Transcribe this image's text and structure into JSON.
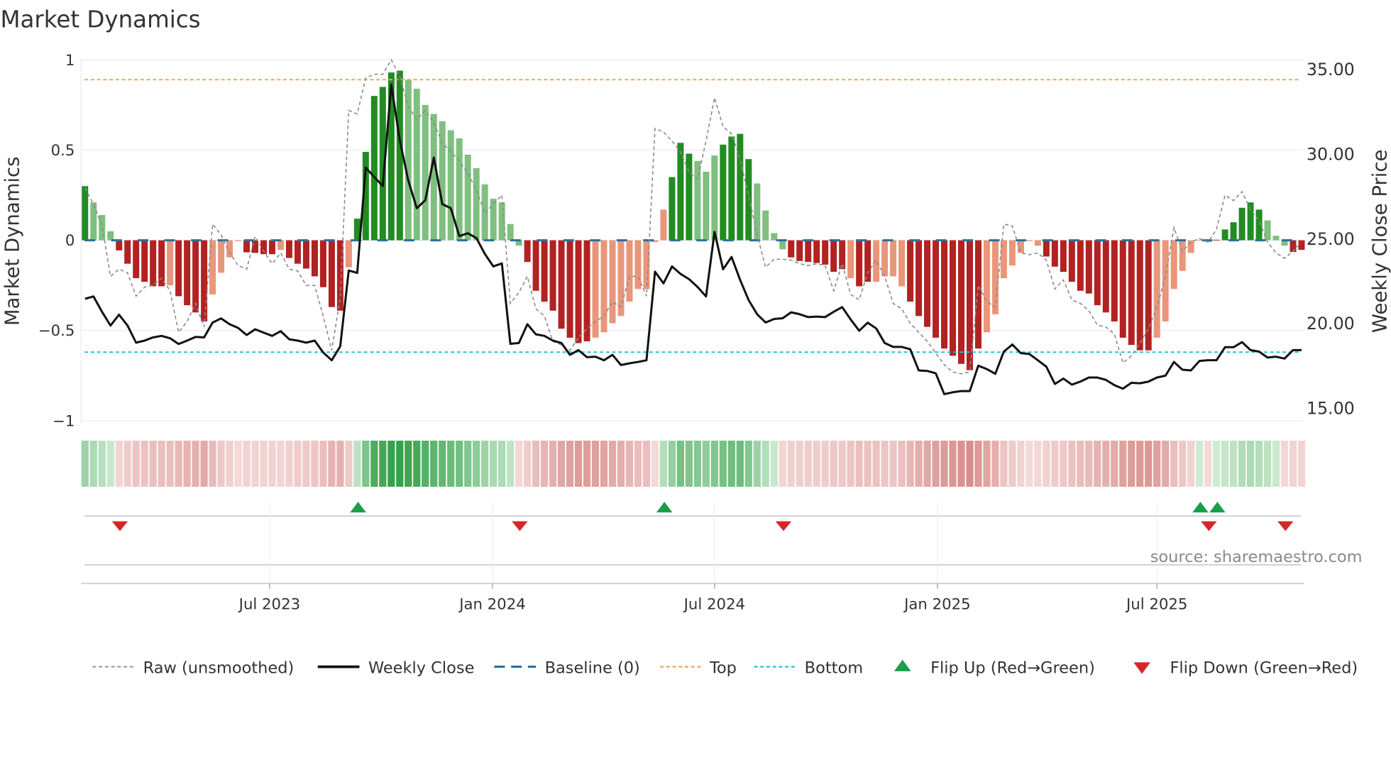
{
  "chart_data": {
    "type": "bar",
    "title": "Market Dynamics",
    "ylabel_left": "Market Dynamics",
    "ylabel_right": "Weekly Close Price",
    "ylim_left": [
      -1,
      1
    ],
    "ylim_right": [
      13.9,
      36.1
    ],
    "left_ticks": [
      {
        "v": 1,
        "label": "1"
      },
      {
        "v": 0.5,
        "label": "0.5"
      },
      {
        "v": 0,
        "label": "0"
      },
      {
        "v": -0.5,
        "label": "−0.5"
      },
      {
        "v": -1,
        "label": "−1"
      }
    ],
    "right_ticks": [
      {
        "v": 35,
        "label": "35.00"
      },
      {
        "v": 30,
        "label": "30.00"
      },
      {
        "v": 25,
        "label": "25.00"
      },
      {
        "v": 20,
        "label": "20.00"
      },
      {
        "v": 15,
        "label": "15.00"
      }
    ],
    "x_ticks": [
      {
        "week": 21.7,
        "label": "Jul 2023"
      },
      {
        "week": 47.9,
        "label": "Jan 2024"
      },
      {
        "week": 74.0,
        "label": "Jul 2024"
      },
      {
        "week": 100.2,
        "label": "Jan 2025"
      },
      {
        "week": 126.0,
        "label": "Jul 2025"
      }
    ],
    "top_level": 0.89,
    "bottom_level": -0.62,
    "baseline": 0,
    "bars": [
      0.3,
      0.21,
      0.14,
      0.05,
      -0.056,
      -0.13,
      -0.21,
      -0.23,
      -0.255,
      -0.255,
      -0.25,
      -0.31,
      -0.36,
      -0.4,
      -0.45,
      -0.3,
      -0.18,
      -0.095,
      -0.005,
      -0.067,
      -0.07,
      -0.077,
      -0.077,
      -0.053,
      -0.098,
      -0.13,
      -0.157,
      -0.2,
      -0.26,
      -0.37,
      -0.39,
      -0.15,
      0.12,
      0.49,
      0.8,
      0.85,
      0.93,
      0.94,
      0.89,
      0.84,
      0.75,
      0.7,
      0.66,
      0.61,
      0.565,
      0.475,
      0.4,
      0.31,
      0.23,
      0.21,
      0.09,
      -0.03,
      -0.12,
      -0.28,
      -0.34,
      -0.39,
      -0.49,
      -0.54,
      -0.57,
      -0.56,
      -0.54,
      -0.51,
      -0.46,
      -0.42,
      -0.34,
      -0.27,
      -0.27,
      -0.01,
      0.17,
      0.35,
      0.54,
      0.48,
      0.44,
      0.38,
      0.47,
      0.53,
      0.575,
      0.59,
      0.45,
      0.315,
      0.165,
      0.04,
      -0.05,
      -0.095,
      -0.115,
      -0.12,
      -0.126,
      -0.135,
      -0.175,
      -0.16,
      -0.21,
      -0.255,
      -0.23,
      -0.23,
      -0.2,
      -0.2,
      -0.255,
      -0.34,
      -0.42,
      -0.48,
      -0.54,
      -0.6,
      -0.64,
      -0.685,
      -0.72,
      -0.6,
      -0.51,
      -0.41,
      -0.21,
      -0.14,
      -0.07,
      -0.005,
      -0.03,
      -0.09,
      -0.146,
      -0.175,
      -0.23,
      -0.28,
      -0.295,
      -0.36,
      -0.4,
      -0.45,
      -0.54,
      -0.58,
      -0.61,
      -0.61,
      -0.54,
      -0.45,
      -0.27,
      -0.17,
      -0.07,
      0.003,
      -0.01,
      0.003,
      0.06,
      0.1,
      0.18,
      0.21,
      0.17,
      0.11,
      0.025,
      -0.03,
      -0.065,
      -0.053
    ],
    "bar_shades": "GggwRRRRRRrRRRRrrrrRRRRrRRRRRRRrGGGGGGggggggggggggggRRRRRRRRrrrrrrrrrGGGgggGGGGggggRRRRRRRrRRrrrrRRRRRRRRRrrrrrrrRRRRRRRRRRRRRrrrrrrgRGGGGGgggRRr",
    "raw": [
      0.29,
      0.2,
      0.08,
      -0.2,
      -0.16,
      -0.18,
      -0.31,
      -0.26,
      -0.25,
      -0.21,
      -0.28,
      -0.51,
      -0.45,
      -0.35,
      -0.48,
      0.09,
      0.03,
      -0.07,
      -0.14,
      -0.16,
      0.02,
      -0.06,
      -0.13,
      -0.07,
      -0.16,
      -0.17,
      -0.25,
      -0.25,
      -0.42,
      -0.61,
      -0.32,
      0.72,
      0.7,
      0.9,
      0.92,
      0.92,
      1.0,
      0.91,
      0.74,
      0.67,
      0.72,
      0.65,
      0.54,
      0.49,
      0.44,
      0.37,
      0.28,
      0.15,
      0.2,
      0.25,
      -0.35,
      -0.29,
      -0.2,
      -0.38,
      -0.42,
      -0.56,
      -0.58,
      -0.61,
      -0.54,
      -0.49,
      -0.45,
      -0.42,
      -0.34,
      -0.37,
      -0.2,
      -0.2,
      -0.31,
      0.62,
      0.6,
      0.55,
      0.49,
      0.38,
      0.34,
      0.55,
      0.79,
      0.63,
      0.59,
      0.45,
      0.25,
      0.03,
      -0.15,
      -0.105,
      -0.105,
      -0.11,
      -0.13,
      -0.14,
      -0.13,
      -0.14,
      -0.28,
      -0.13,
      -0.3,
      -0.33,
      -0.18,
      -0.11,
      -0.2,
      -0.35,
      -0.38,
      -0.46,
      -0.51,
      -0.56,
      -0.625,
      -0.69,
      -0.73,
      -0.74,
      -0.73,
      -0.25,
      -0.34,
      -0.37,
      0.09,
      0.08,
      -0.07,
      -0.08,
      -0.07,
      -0.11,
      -0.27,
      -0.22,
      -0.33,
      -0.35,
      -0.39,
      -0.47,
      -0.48,
      -0.52,
      -0.68,
      -0.64,
      -0.57,
      -0.49,
      -0.37,
      -0.2,
      0.07,
      -0.06,
      -0.01,
      0.01,
      -0.01,
      0.06,
      0.25,
      0.22,
      0.27,
      0.17,
      0.11,
      -0.01,
      -0.07,
      -0.1,
      -0.06,
      -0.01
    ],
    "close": [
      21.44,
      21.58,
      20.67,
      19.86,
      20.5,
      19.86,
      18.85,
      18.97,
      19.16,
      19.25,
      19.11,
      18.77,
      18.97,
      19.19,
      19.16,
      20.04,
      20.28,
      19.94,
      19.72,
      19.3,
      19.64,
      19.44,
      19.25,
      19.53,
      19.05,
      18.97,
      18.85,
      18.97,
      18.27,
      17.81,
      18.63,
      23.11,
      22.97,
      29.19,
      28.63,
      28.1,
      34.08,
      30.8,
      28.42,
      26.79,
      27.26,
      29.78,
      27.03,
      26.79,
      25.14,
      25.31,
      25.03,
      24.09,
      23.35,
      23.53,
      18.78,
      18.83,
      19.94,
      19.34,
      19.25,
      18.97,
      18.83,
      18.13,
      18.41,
      17.99,
      18.02,
      17.81,
      18.13,
      17.53,
      17.63,
      17.71,
      17.81,
      23.04,
      22.35,
      23.35,
      22.91,
      22.6,
      22.14,
      21.58,
      25.39,
      23.18,
      23.91,
      22.56,
      21.37,
      20.53,
      20.04,
      20.25,
      20.29,
      20.64,
      20.53,
      20.36,
      20.39,
      20.36,
      20.67,
      20.95,
      20.22,
      19.55,
      20.03,
      19.69,
      18.83,
      18.6,
      18.6,
      18.46,
      17.21,
      17.18,
      17.04,
      15.81,
      15.92,
      15.99,
      15.99,
      17.49,
      17.29,
      17.01,
      18.32,
      18.74,
      18.23,
      18.18,
      17.81,
      17.43,
      16.41,
      16.73,
      16.37,
      16.55,
      16.79,
      16.79,
      16.65,
      16.34,
      16.13,
      16.48,
      16.45,
      16.55,
      16.79,
      16.9,
      17.71,
      17.25,
      17.21,
      17.77,
      17.81,
      17.81,
      18.58,
      18.58,
      18.88,
      18.41,
      18.32,
      17.97,
      18.02,
      17.91,
      18.41,
      18.41
    ],
    "flip_up_weeks": [
      32,
      68,
      131,
      133
    ],
    "flip_down_weeks": [
      4,
      51,
      82,
      132,
      141
    ],
    "legend": {
      "placement": "bottom",
      "raw": "Raw (unsmoothed)",
      "close": "Weekly Close",
      "baseline": "Baseline (0)",
      "top": "Top",
      "bottom": "Bottom",
      "flip_up": "Flip Up (Red→Green)",
      "flip_down": "Flip Down (Green→Red)"
    },
    "source": "source: sharemaestro.com",
    "colors": {
      "strong_green": "#228b22",
      "weak_green": "#7fbf7f",
      "strong_red": "#b22222",
      "weak_red": "#e9967a",
      "close": "#111111",
      "raw": "#8c8c8c",
      "baseline": "#2a6f9e",
      "top": "#f4a460",
      "bottom": "#22c3d6",
      "flip_up": "#1a9e4a",
      "flip_down": "#d62728"
    }
  }
}
